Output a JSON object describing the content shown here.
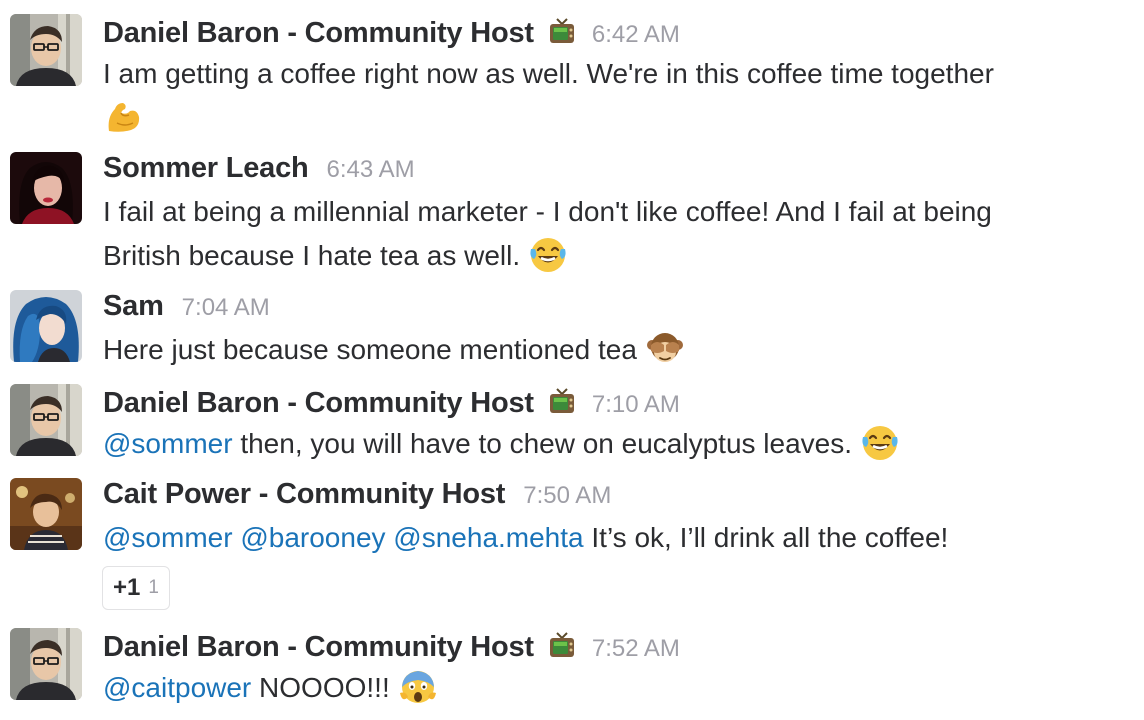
{
  "messages": [
    {
      "sender": "Daniel Baron - Community Host",
      "status_icon": "tv-icon",
      "time": "6:42 AM",
      "lines": [
        {
          "text": "I am getting a coffee right now as well. We're in this coffee time together"
        }
      ],
      "emoji": "flexed-biceps-icon"
    },
    {
      "sender": "Sommer Leach",
      "time": "6:43 AM",
      "lines": [
        {
          "text": "I fail at being a millennial marketer - I don't like coffee! And I fail at being"
        },
        {
          "text": "British because I hate tea as well."
        }
      ],
      "emoji": "tears-of-joy-icon"
    },
    {
      "sender": "Sam",
      "time": "7:04 AM",
      "lines": [
        {
          "text": "Here just because someone mentioned tea"
        }
      ],
      "emoji": "see-no-evil-monkey-icon"
    },
    {
      "sender": "Daniel Baron - Community Host",
      "status_icon": "tv-icon",
      "time": "7:10 AM",
      "mention": "@sommer",
      "text": " then, you will have to chew on eucalyptus leaves.",
      "emoji": "tears-of-joy-icon"
    },
    {
      "sender": "Cait Power - Community Host",
      "time": "7:50 AM",
      "mentions": [
        "@sommer",
        "@barooney",
        "@sneha.mehta"
      ],
      "text": " It’s ok, I’ll drink all the coffee!",
      "reaction": {
        "label": "+1",
        "count": "1"
      }
    },
    {
      "sender": "Daniel Baron - Community Host",
      "status_icon": "tv-icon",
      "time": "7:52 AM",
      "mention": "@caitpower",
      "text": " NOOOO!!!",
      "emoji": "screaming-in-fear-icon"
    }
  ],
  "colors": {
    "mention": "#1a73b8",
    "timestamp": "#9e9ea6",
    "text": "#2c2d30"
  }
}
